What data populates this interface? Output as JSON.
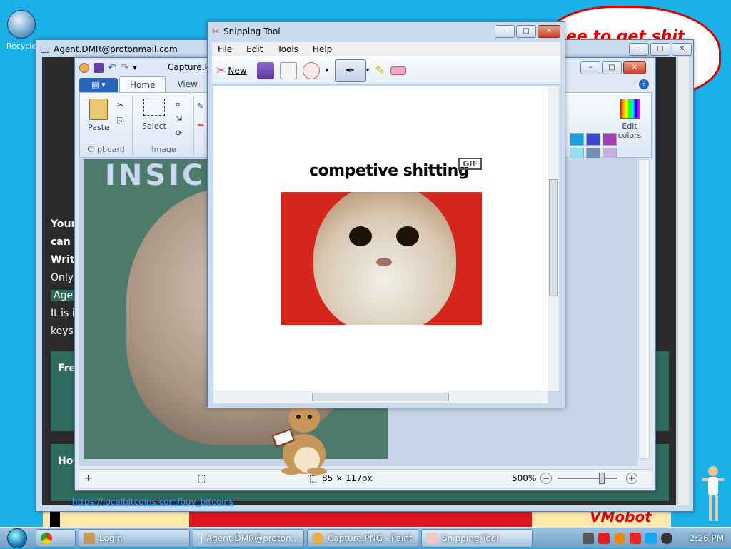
{
  "desktop": {
    "recycle_label": "Recycle",
    "bubble_text": "ee to get shit",
    "banner_text": "VMobot"
  },
  "mail_window": {
    "title": "Agent.DMR@protonmail.com",
    "lines": [
      "Your",
      "can r",
      "Writ",
      "Only",
      "Agen",
      "It is i",
      "keys"
    ],
    "box1_label": "Fre",
    "box2_label": "Hov",
    "link": "https://localbitcoins.com/buy_bitcoins"
  },
  "paint_window": {
    "title": "Capture.PNG",
    "tabs": {
      "file": "▤ ▾",
      "home": "Home",
      "view": "View"
    },
    "groups": {
      "paste": "Paste",
      "clipboard": "Clipboard",
      "select": "Select",
      "image": "Image",
      "edit_colors": "Edit colors"
    },
    "canvas_text": "INSIC",
    "status_size": "85 × 117px",
    "zoom": "500%"
  },
  "snip_window": {
    "title": "Snipping Tool",
    "menu": [
      "File",
      "Edit",
      "Tools",
      "Help"
    ],
    "new_label": "New",
    "gif_caption": "competive shitting",
    "gif_badge": "GIF"
  },
  "taskbar": {
    "items": [
      {
        "label": "Login"
      },
      {
        "label": "Agent.DMR@proton..."
      },
      {
        "label": "Capture.PNG - Paint"
      },
      {
        "label": "Snipping Tool"
      }
    ],
    "clock": "2:26 PM"
  },
  "colors": {
    "desktop": "#1ab0e8",
    "accent_red": "#e0141e",
    "paint_file_tab": "#2a64b8"
  }
}
